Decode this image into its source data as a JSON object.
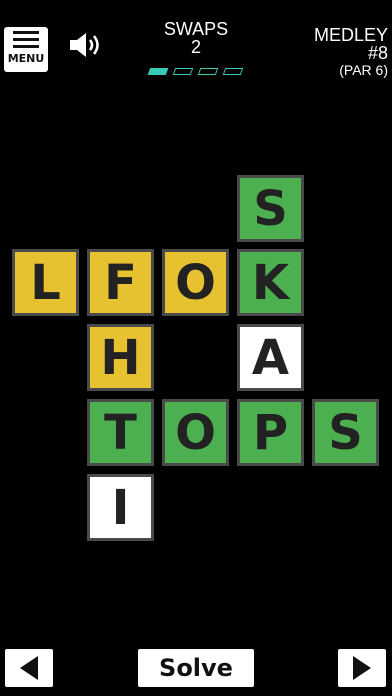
{
  "header": {
    "menu_label": "MENU",
    "swaps_label": "SWAPS",
    "swaps_count": "2",
    "swaps_remaining_fraction": 0.25,
    "medley_label": "MEDLEY",
    "puzzle_number": "#8",
    "par_label": "(PAR 6)"
  },
  "board": {
    "tiles": [
      {
        "letter": "S",
        "state": "green"
      },
      {
        "letter": "L",
        "state": "yellow"
      },
      {
        "letter": "F",
        "state": "yellow"
      },
      {
        "letter": "O",
        "state": "yellow"
      },
      {
        "letter": "K",
        "state": "green"
      },
      {
        "letter": "H",
        "state": "yellow"
      },
      {
        "letter": "A",
        "state": "white"
      },
      {
        "letter": "T",
        "state": "green"
      },
      {
        "letter": "O",
        "state": "green"
      },
      {
        "letter": "P",
        "state": "green"
      },
      {
        "letter": "S",
        "state": "green"
      },
      {
        "letter": "I",
        "state": "white"
      }
    ]
  },
  "footer": {
    "solve_label": "Solve"
  },
  "colors": {
    "green": "#4caf50",
    "yellow": "#e6c231",
    "white": "#ffffff",
    "accent": "#39c9b6",
    "background": "#000000"
  },
  "icons": {
    "menu": "hamburger-icon",
    "sound": "speaker-icon",
    "prev": "triangle-left-icon",
    "next": "triangle-right-icon"
  }
}
